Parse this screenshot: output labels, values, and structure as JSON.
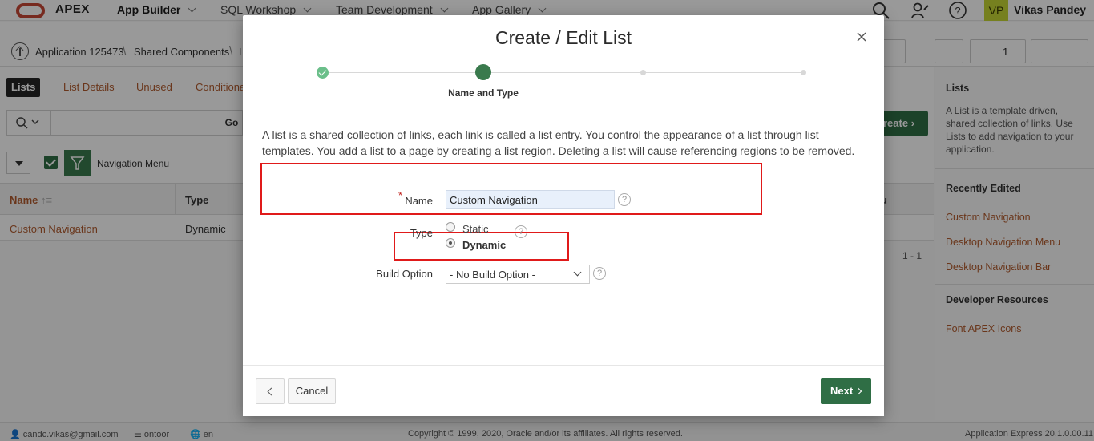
{
  "header": {
    "logo": "APEX",
    "nav": [
      {
        "label": "App Builder"
      },
      {
        "label": "SQL Workshop"
      },
      {
        "label": "Team Development"
      },
      {
        "label": "App Gallery"
      }
    ],
    "user_initials": "VP",
    "user_name": "Vikas Pandey"
  },
  "breadcrumb": {
    "items": [
      "Application 125473",
      "Shared Components",
      "L"
    ]
  },
  "toolbar": {
    "page_number": "1"
  },
  "tabs": [
    "Lists",
    "List Details",
    "Unused",
    "Conditional"
  ],
  "search": {
    "go_label": "Go",
    "create_label": "reate"
  },
  "filter": {
    "label": "Navigation Menu"
  },
  "table": {
    "columns": [
      "Name",
      "Type",
      "u"
    ],
    "rows": [
      {
        "name": "Custom Navigation",
        "type": "Dynamic"
      }
    ],
    "count": "1 - 1"
  },
  "sidebar": {
    "lists_title": "Lists",
    "lists_text": "A List is a template driven, shared collection of links. Use Lists to add navigation to your application.",
    "recent_title": "Recently Edited",
    "recent": [
      "Custom Navigation",
      "Desktop Navigation Menu",
      "Desktop Navigation Bar"
    ],
    "dev_title": "Developer Resources",
    "dev_links": [
      "Font APEX Icons"
    ]
  },
  "footer": {
    "email": "candc.vikas@gmail.com",
    "workspace": "ontoor",
    "language": "en",
    "copyright": "Copyright © 1999, 2020, Oracle and/or its affiliates. All rights reserved.",
    "version": "Application Express 20.1.0.00.11"
  },
  "dialog": {
    "title": "Create / Edit List",
    "step_label": "Name and Type",
    "description": "A list is a shared collection of links, each link is called a list entry. You control the appearance of a list through list templates. You add a list to a page by creating a list region. Deleting a list will cause referencing regions to be removed.",
    "name_label": "Name",
    "required_mark": "*",
    "name_value": "Custom Navigation",
    "type_label": "Type",
    "type_options": [
      "Static",
      "Dynamic"
    ],
    "type_selected": "Dynamic",
    "build_option_label": "Build Option",
    "build_option_value": "- No Build Option -",
    "help_glyph": "?",
    "cancel_label": "Cancel",
    "next_label": "Next"
  },
  "colors": {
    "accent_green": "#2f6e45",
    "link_orange": "#b15b2e",
    "highlight_red": "#e01a1a",
    "oracle_red": "#c74634"
  }
}
